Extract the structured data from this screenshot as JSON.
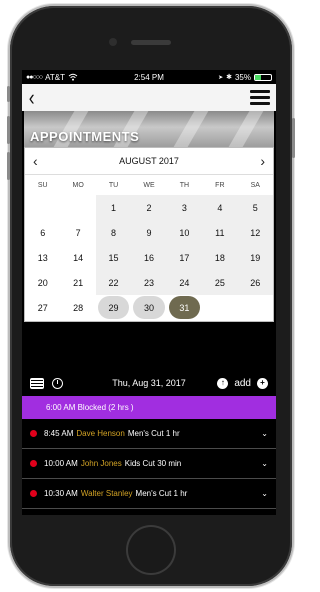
{
  "status_bar": {
    "signal": "●●○○○",
    "carrier": "AT&T",
    "wifi": "wifi-icon",
    "time": "2:54 PM",
    "location": "➤",
    "bluetooth": "✱",
    "battery_text": "35%",
    "battery_level": 0.35
  },
  "nav": {
    "back": "‹"
  },
  "banner": {
    "title": "APPOINTMENTS"
  },
  "calendar": {
    "prev": "‹",
    "next": "›",
    "month": "AUGUST 2017",
    "weekdays": [
      "SU",
      "MO",
      "TU",
      "WE",
      "TH",
      "FR",
      "SA"
    ],
    "weeks": [
      [
        "",
        "",
        "1",
        "2",
        "3",
        "4",
        "5"
      ],
      [
        "6",
        "7",
        "8",
        "9",
        "10",
        "11",
        "12"
      ],
      [
        "13",
        "14",
        "15",
        "16",
        "17",
        "18",
        "19"
      ],
      [
        "20",
        "21",
        "22",
        "23",
        "24",
        "25",
        "26"
      ],
      [
        "27",
        "28",
        "29",
        "30",
        "31",
        "",
        ""
      ]
    ],
    "selected_day": "31",
    "highlighted_days": [
      "29",
      "30"
    ]
  },
  "toolbar": {
    "date": "Thu, Aug 31, 2017",
    "add_label": "add",
    "add_icon": "+",
    "up_icon": "↑"
  },
  "blocked": {
    "label": "6:00 AM Blocked (2 hrs )",
    "color": "#a12ee0"
  },
  "appointments": [
    {
      "time": "8:45 AM",
      "client": "Dave Henson",
      "service": "Men's Cut 1 hr"
    },
    {
      "time": "10:00 AM",
      "client": "John Jones",
      "service": "Kids Cut 30 min"
    },
    {
      "time": "10:30 AM",
      "client": "Walter Stanley",
      "service": "Men's Cut 1 hr"
    }
  ],
  "colors": {
    "client_name": "#d3a325",
    "status_dot": "#e0001b",
    "selected_day": "#6f6a50"
  }
}
